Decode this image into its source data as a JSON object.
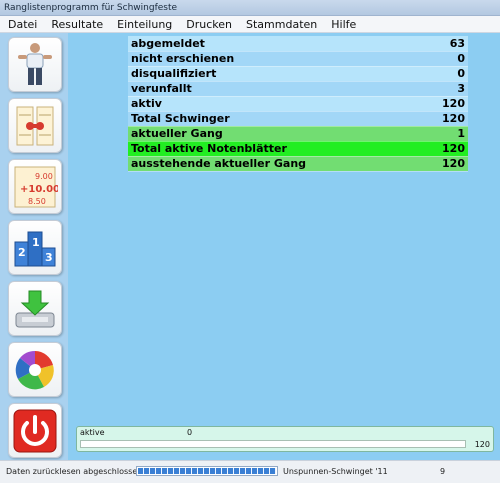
{
  "window": {
    "title": "Ranglistenprogramm für Schwingfeste"
  },
  "menu": [
    {
      "label": "Datei"
    },
    {
      "label": "Resultate"
    },
    {
      "label": "Einteilung"
    },
    {
      "label": "Drucken"
    },
    {
      "label": "Stammdaten"
    },
    {
      "label": "Hilfe"
    }
  ],
  "sidebar": [
    {
      "icon": "wrestler-icon"
    },
    {
      "icon": "pairing-icon"
    },
    {
      "icon": "scores-icon"
    },
    {
      "icon": "podium-icon"
    },
    {
      "icon": "download-icon"
    },
    {
      "icon": "pie-chart-icon"
    },
    {
      "icon": "power-icon"
    }
  ],
  "summary": {
    "rows": [
      {
        "label": "abgemeldet",
        "value": "63",
        "style": "light"
      },
      {
        "label": "nicht erschienen",
        "value": "0",
        "style": "mid"
      },
      {
        "label": "disqualifiziert",
        "value": "0",
        "style": "light"
      },
      {
        "label": "verunfallt",
        "value": "3",
        "style": "mid"
      },
      {
        "label": "aktiv",
        "value": "120",
        "style": "light"
      },
      {
        "label": "Total Schwinger",
        "value": "120",
        "style": "mid"
      },
      {
        "label": "aktueller Gang",
        "value": "1",
        "style": "green"
      },
      {
        "label": "Total aktive Notenblätter",
        "value": "120",
        "style": "bright"
      },
      {
        "label": "ausstehende aktueller Gang",
        "value": "120",
        "style": "green"
      }
    ]
  },
  "progress": {
    "label": "aktive",
    "min_label": "0",
    "max_label": "120",
    "fraction": 0.0
  },
  "status": {
    "text": "Daten zurücklesen abgeschlossen",
    "progress_fraction": 1.0,
    "event": "Unspunnen-Schwinget '11",
    "number": "9"
  },
  "colors": {
    "main_bg": "#8ccdf2",
    "row_light": "#b6e4fb",
    "row_mid": "#a2d7f7",
    "row_green": "#72dd72",
    "row_bright": "#22ee22"
  }
}
